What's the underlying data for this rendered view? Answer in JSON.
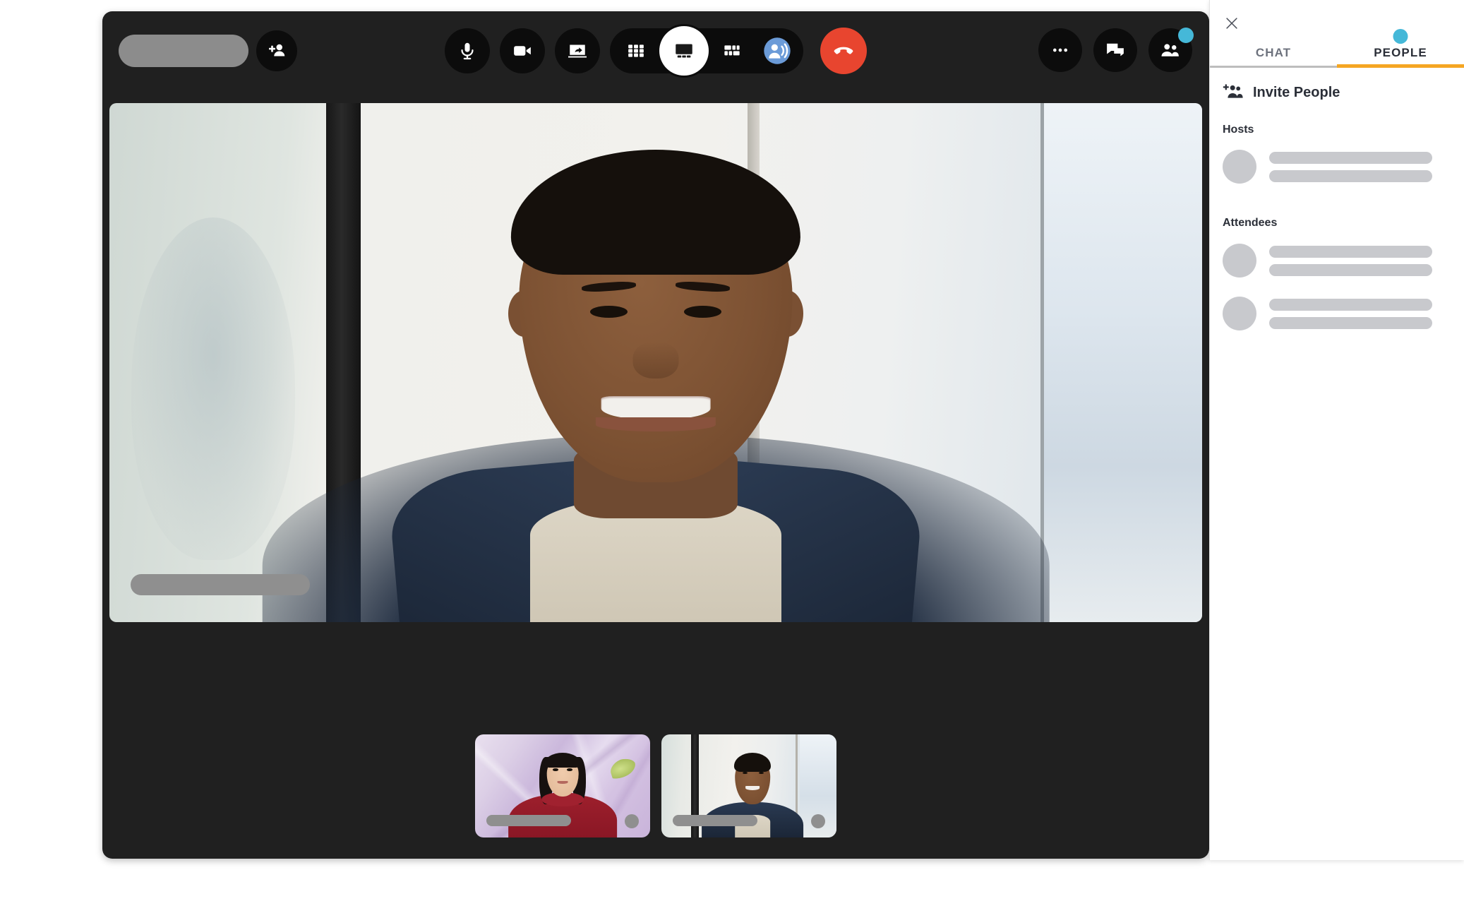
{
  "window": {
    "title_placeholder": "",
    "toolbar": {
      "add_person_label": "Add people",
      "mic_label": "Mute",
      "camera_label": "Stop video",
      "share_label": "Share screen",
      "layout_grid_label": "Grid layout",
      "layout_stage_label": "Stage layout",
      "layout_focus_label": "Focus layout",
      "audio_label": "Audio settings",
      "hangup_label": "Leave meeting",
      "more_label": "More options",
      "chat_label": "Chat",
      "people_label": "People"
    }
  },
  "stage": {
    "participant_name_placeholder": ""
  },
  "thumbnails": [
    {
      "name_placeholder": "",
      "mic_state": "muted"
    },
    {
      "name_placeholder": "",
      "mic_state": "muted"
    }
  ],
  "sidebar": {
    "close_label": "Close panel",
    "tabs": [
      {
        "label": "CHAT",
        "active": false,
        "has_dot": false
      },
      {
        "label": "PEOPLE",
        "active": true,
        "has_dot": true
      }
    ],
    "invite": {
      "label": "Invite People",
      "icon": "add-people-icon"
    },
    "groups": [
      {
        "title": "Hosts",
        "people": [
          {
            "name_placeholder": "",
            "detail_placeholder": ""
          }
        ]
      },
      {
        "title": "Attendees",
        "people": [
          {
            "name_placeholder": "",
            "detail_placeholder": ""
          },
          {
            "name_placeholder": "",
            "detail_placeholder": ""
          }
        ]
      }
    ]
  },
  "colors": {
    "accent_orange": "#f5a623",
    "badge_blue": "#45b8d8",
    "hangup_red": "#e8452f",
    "audio_blue": "#6b9bd8",
    "window_dark": "#202020",
    "button_dark": "#0c0c0c",
    "placeholder_gray": "#c8c9cd"
  }
}
